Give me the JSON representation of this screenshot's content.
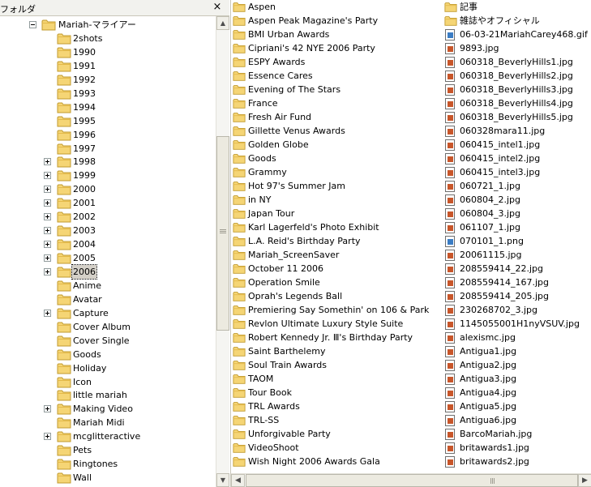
{
  "left_pane": {
    "title": "フォルダ",
    "close_label": "×",
    "tree": {
      "root": "Mariah-マライアー",
      "children": [
        {
          "label": "2shots",
          "expandable": false
        },
        {
          "label": "1990",
          "expandable": false
        },
        {
          "label": "1991",
          "expandable": false
        },
        {
          "label": "1992",
          "expandable": false
        },
        {
          "label": "1993",
          "expandable": false
        },
        {
          "label": "1994",
          "expandable": false
        },
        {
          "label": "1995",
          "expandable": false
        },
        {
          "label": "1996",
          "expandable": false
        },
        {
          "label": "1997",
          "expandable": false
        },
        {
          "label": "1998",
          "expandable": true
        },
        {
          "label": "1999",
          "expandable": true
        },
        {
          "label": "2000",
          "expandable": true
        },
        {
          "label": "2001",
          "expandable": true
        },
        {
          "label": "2002",
          "expandable": true
        },
        {
          "label": "2003",
          "expandable": true
        },
        {
          "label": "2004",
          "expandable": true
        },
        {
          "label": "2005",
          "expandable": true
        },
        {
          "label": "2006",
          "expandable": true,
          "selected": true
        },
        {
          "label": "Anime",
          "expandable": false
        },
        {
          "label": "Avatar",
          "expandable": false
        },
        {
          "label": "Capture",
          "expandable": true
        },
        {
          "label": "Cover Album",
          "expandable": false
        },
        {
          "label": "Cover Single",
          "expandable": false
        },
        {
          "label": "Goods",
          "expandable": false
        },
        {
          "label": "Holiday",
          "expandable": false
        },
        {
          "label": "Icon",
          "expandable": false
        },
        {
          "label": "little mariah",
          "expandable": false
        },
        {
          "label": "Making Video",
          "expandable": true
        },
        {
          "label": "Mariah Midi",
          "expandable": false
        },
        {
          "label": "mcglitteractive",
          "expandable": true
        },
        {
          "label": "Pets",
          "expandable": false
        },
        {
          "label": "Ringtones",
          "expandable": false
        },
        {
          "label": "Wall",
          "expandable": false
        }
      ]
    }
  },
  "right_pane": {
    "columns": [
      {
        "items": [
          {
            "name": "Aspen",
            "type": "folder"
          },
          {
            "name": "Aspen Peak Magazine's Party",
            "type": "folder"
          },
          {
            "name": "BMI Urban Awards",
            "type": "folder"
          },
          {
            "name": "Cipriani's 42 NYE 2006 Party",
            "type": "folder"
          },
          {
            "name": "ESPY Awards",
            "type": "folder"
          },
          {
            "name": "Essence Cares",
            "type": "folder"
          },
          {
            "name": "Evening of The Stars",
            "type": "folder"
          },
          {
            "name": "France",
            "type": "folder"
          },
          {
            "name": "Fresh Air Fund",
            "type": "folder"
          },
          {
            "name": "Gillette Venus Awards",
            "type": "folder"
          },
          {
            "name": "Golden Globe",
            "type": "folder"
          },
          {
            "name": "Goods",
            "type": "folder"
          },
          {
            "name": "Grammy",
            "type": "folder"
          },
          {
            "name": "Hot 97's Summer Jam",
            "type": "folder"
          },
          {
            "name": "in NY",
            "type": "folder"
          },
          {
            "name": "Japan Tour",
            "type": "folder"
          },
          {
            "name": "Karl Lagerfeld's Photo Exhibit",
            "type": "folder"
          },
          {
            "name": "L.A. Reid's Birthday Party",
            "type": "folder"
          },
          {
            "name": "Mariah_ScreenSaver",
            "type": "folder"
          },
          {
            "name": "October 11 2006",
            "type": "folder"
          },
          {
            "name": "Operation Smile",
            "type": "folder"
          },
          {
            "name": "Oprah's Legends Ball",
            "type": "folder"
          },
          {
            "name": "Premiering  Say Somethin'  on 106 & Park",
            "type": "folder"
          },
          {
            "name": "Revlon Ultimate Luxury Style Suite",
            "type": "folder"
          },
          {
            "name": "Robert Kennedy Jr. Ⅲ's Birthday Party",
            "type": "folder"
          },
          {
            "name": "Saint Barthelemy",
            "type": "folder"
          },
          {
            "name": "Soul Train Awards",
            "type": "folder"
          },
          {
            "name": "TAOM",
            "type": "folder"
          },
          {
            "name": "Tour Book",
            "type": "folder"
          },
          {
            "name": "TRL Awards",
            "type": "folder"
          },
          {
            "name": "TRL-SS",
            "type": "folder"
          },
          {
            "name": "Unforgivable Party",
            "type": "folder"
          },
          {
            "name": "VideoShoot",
            "type": "folder"
          },
          {
            "name": "Wish Night 2006 Awards Gala",
            "type": "folder"
          }
        ]
      },
      {
        "items": [
          {
            "name": "記事",
            "type": "folder"
          },
          {
            "name": "雑誌やオフィシャル",
            "type": "folder"
          },
          {
            "name": "06-03-21MariahCarey468.gif",
            "type": "gif"
          },
          {
            "name": "9893.jpg",
            "type": "jpg"
          },
          {
            "name": "060318_BeverlyHills1.jpg",
            "type": "jpg"
          },
          {
            "name": "060318_BeverlyHills2.jpg",
            "type": "jpg"
          },
          {
            "name": "060318_BeverlyHills3.jpg",
            "type": "jpg"
          },
          {
            "name": "060318_BeverlyHills4.jpg",
            "type": "jpg"
          },
          {
            "name": "060318_BeverlyHills5.jpg",
            "type": "jpg"
          },
          {
            "name": "060328mara11.jpg",
            "type": "jpg"
          },
          {
            "name": "060415_intel1.jpg",
            "type": "jpg"
          },
          {
            "name": "060415_intel2.jpg",
            "type": "jpg"
          },
          {
            "name": "060415_intel3.jpg",
            "type": "jpg"
          },
          {
            "name": "060721_1.jpg",
            "type": "jpg"
          },
          {
            "name": "060804_2.jpg",
            "type": "jpg"
          },
          {
            "name": "060804_3.jpg",
            "type": "jpg"
          },
          {
            "name": "061107_1.jpg",
            "type": "jpg"
          },
          {
            "name": "070101_1.png",
            "type": "png"
          },
          {
            "name": "20061115.jpg",
            "type": "jpg"
          },
          {
            "name": "208559414_22.jpg",
            "type": "jpg"
          },
          {
            "name": "208559414_167.jpg",
            "type": "jpg"
          },
          {
            "name": "208559414_205.jpg",
            "type": "jpg"
          },
          {
            "name": "230268702_3.jpg",
            "type": "jpg"
          },
          {
            "name": "1145055001H1nyVSUV.jpg",
            "type": "jpg"
          },
          {
            "name": "alexismc.jpg",
            "type": "jpg"
          },
          {
            "name": "Antigua1.jpg",
            "type": "jpg"
          },
          {
            "name": "Antigua2.jpg",
            "type": "jpg"
          },
          {
            "name": "Antigua3.jpg",
            "type": "jpg"
          },
          {
            "name": "Antigua4.jpg",
            "type": "jpg"
          },
          {
            "name": "Antigua5.jpg",
            "type": "jpg"
          },
          {
            "name": "Antigua6.jpg",
            "type": "jpg"
          },
          {
            "name": "BarcoMariah.jpg",
            "type": "jpg"
          },
          {
            "name": "britawards1.jpg",
            "type": "jpg"
          },
          {
            "name": "britawards2.jpg",
            "type": "jpg"
          }
        ]
      }
    ]
  },
  "colors": {
    "folder": "#f5d575",
    "folder_edge": "#c19a2e",
    "jpg_picture": "#c8562a",
    "gif_picture": "#3b7dc4"
  },
  "icons": {
    "folder": "folder-icon",
    "image_file": "image-file-icon",
    "close": "close-icon",
    "expand": "expand-plus-icon",
    "collapse": "collapse-minus-icon"
  }
}
